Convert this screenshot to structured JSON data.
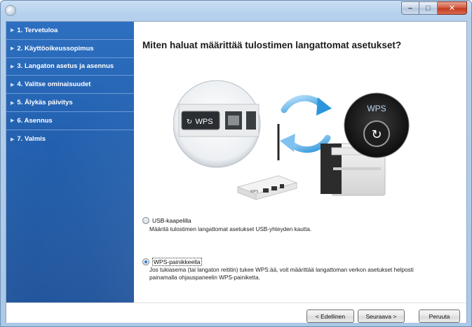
{
  "window": {
    "buttons": {
      "minimize": "–",
      "maximize": "□",
      "close": "✕"
    }
  },
  "sidebar": {
    "items": [
      {
        "label": "1. Tervetuloa"
      },
      {
        "label": "2. Käyttöoikeussopimus"
      },
      {
        "label": "3. Langaton asetus ja asennus"
      },
      {
        "label": "4. Valitse ominaisuudet"
      },
      {
        "label": "5. Älykäs päivitys"
      },
      {
        "label": "6. Asennus"
      },
      {
        "label": "7. Valmis"
      }
    ]
  },
  "main": {
    "question": "Miten haluat määrittää tulostimen langattomat asetukset?",
    "illustration": {
      "router_button_label": "WPS",
      "printer_button_label": "WPS",
      "router_small_label": "WPS"
    },
    "options": [
      {
        "label": "USB-kaapelilla",
        "description": "Määritä tulostimen langattomat asetukset USB-yhteyden kautta.",
        "checked": false
      },
      {
        "label": "WPS-painikkeella",
        "description_line1": "Jos tukiasema (tai langaton reititin) tukee WPS:ää, voit määrittää langattoman verkon asetukset helposti",
        "description_line2": "painamalla ohjauspaneelin WPS-painiketta.",
        "checked": true
      }
    ]
  },
  "footer": {
    "back_label": "< Edellinen",
    "next_label": "Seuraava >",
    "cancel_label": "Peruuta"
  },
  "colors": {
    "sidebar": "#2361b0",
    "accent": "#2a7bd6",
    "close_button": "#c2381c"
  }
}
